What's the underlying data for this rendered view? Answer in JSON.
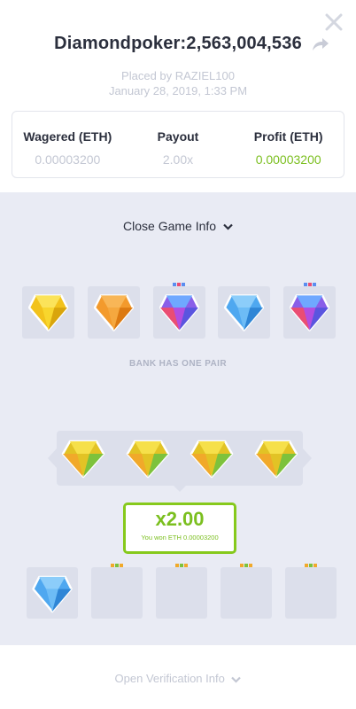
{
  "header": {
    "title": "Diamondpoker:2,563,004,536",
    "placed_by": "Placed by RAZIEL100",
    "date": "January 28, 2019, 1:33 PM"
  },
  "stats": [
    {
      "label": "Wagered (ETH)",
      "value": "0.00003200"
    },
    {
      "label": "Payout",
      "value": "2.00x"
    },
    {
      "label": "Profit (ETH)",
      "value": "0.00003200"
    }
  ],
  "game": {
    "toggle_label": "Close Game Info",
    "bank_label": "BANK HAS ONE PAIR",
    "bank_gems": [
      "yellow",
      "orange",
      "rainbow",
      "blue",
      "rainbow"
    ],
    "pair_gems": [
      "yellow-green",
      "yellow-green",
      "yellow-green",
      "yellow-green"
    ],
    "win": {
      "multiplier": "x2.00",
      "text": "You won ETH 0.00003200"
    },
    "player_tiles": [
      "blue",
      "hidden",
      "hidden",
      "hidden",
      "hidden"
    ]
  },
  "footer": {
    "verification_label": "Open Verification Info"
  },
  "colors": {
    "accent_green": "#7bbf1f",
    "title": "#2b2f3d",
    "muted": "#c3c7d3",
    "game_bg": "#e9ebf4"
  }
}
